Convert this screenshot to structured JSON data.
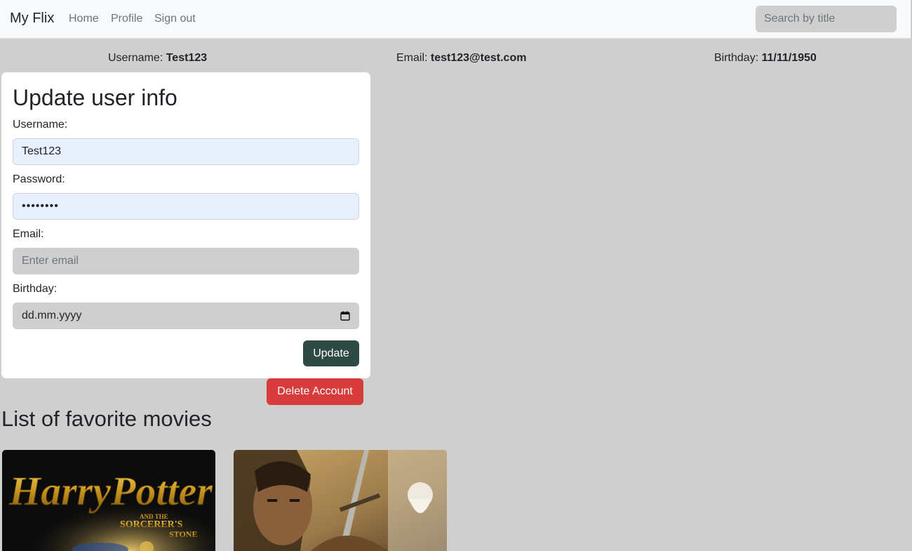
{
  "navbar": {
    "brand": "My Flix",
    "links": [
      "Home",
      "Profile",
      "Sign out"
    ],
    "search_placeholder": "Search by title"
  },
  "user_info": {
    "username_label": "Username:",
    "username": "Test123",
    "email_label": "Email:",
    "email": "test123@test.com",
    "birthday_label": "Birthday:",
    "birthday": "11/11/1950"
  },
  "update_form": {
    "title": "Update user info",
    "username_label": "Username:",
    "username_value": "Test123",
    "password_label": "Password:",
    "password_value": "••••••••",
    "email_label": "Email:",
    "email_placeholder": "Enter email",
    "birthday_label": "Birthday:",
    "birthday_placeholder": "dd.mm.yyyy",
    "update_button": "Update"
  },
  "delete_button": "Delete Account",
  "favorites": {
    "title": "List of favorite movies",
    "movies": [
      {
        "poster_text_1": "HarryPotter",
        "poster_text_2": "AND THE",
        "poster_text_3": "SORCERER'S",
        "poster_text_4": "STONE",
        "icon": "harry-potter-poster-icon"
      },
      {
        "icon": "lord-of-the-rings-poster-icon"
      }
    ]
  },
  "colors": {
    "background": "#cfcfcf",
    "navbar": "#f8f9fa",
    "update_button": "#2f4a45",
    "delete_button": "#d73b3b",
    "autofill": "#e8f0fe"
  }
}
